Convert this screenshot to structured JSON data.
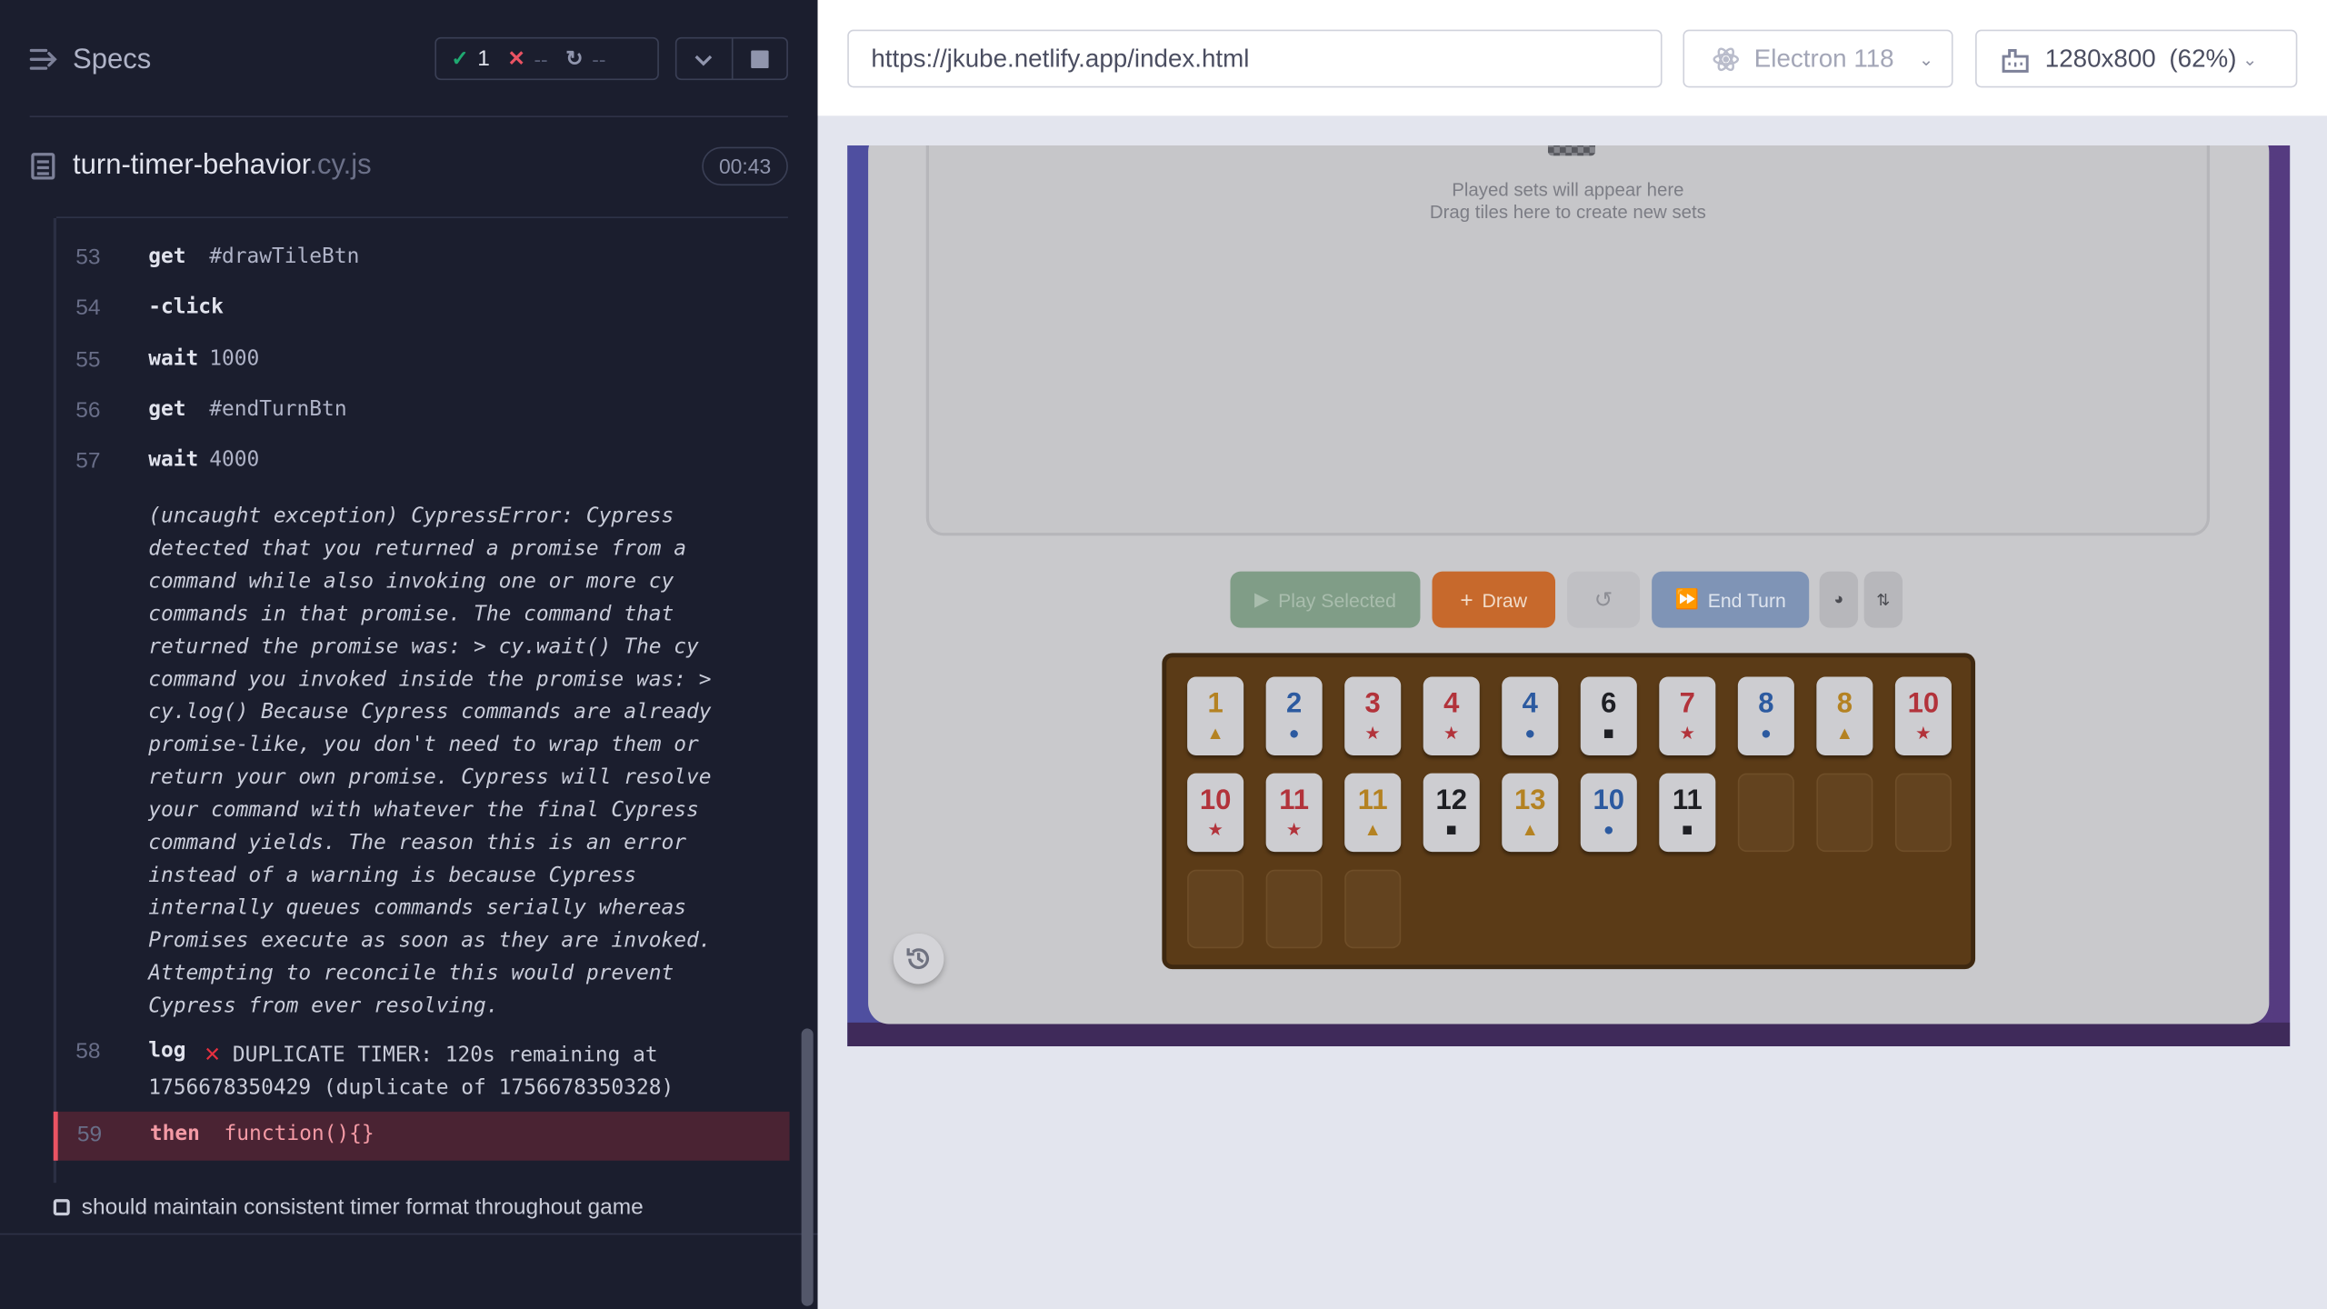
{
  "reporter": {
    "title": "Specs",
    "stats": {
      "passed": "1",
      "failed": "--",
      "pending": "--"
    },
    "spec": {
      "name": "turn-timer-behavior",
      "ext": ".cy.js",
      "duration": "00:43"
    },
    "commands": [
      {
        "num": "53",
        "name": "get",
        "message": "#drawTileBtn"
      },
      {
        "num": "54",
        "name": "-click",
        "message": ""
      },
      {
        "num": "55",
        "name": "wait",
        "message": "1000"
      },
      {
        "num": "56",
        "name": "get",
        "message": "#endTurnBtn"
      },
      {
        "num": "57",
        "name": "wait",
        "message": "4000"
      }
    ],
    "error_text": "(uncaught exception)  CypressError: Cypress detected that you returned a promise from a command while also invoking one or more cy commands in that promise. The command that returned the promise was: > cy.wait() The cy command you invoked inside the promise was: > cy.log() Because Cypress commands are already promise-like, you don't need to wrap them or return your own promise. Cypress will resolve your command with whatever the final Cypress command yields. The reason this is an error instead of a warning is because Cypress internally queues commands serially whereas Promises execute as soon as they are invoked. Attempting to reconcile this would prevent Cypress from ever resolving.",
    "log_command": {
      "num": "58",
      "name": "log",
      "message_line1": "DUPLICATE TIMER: 120s remaining at",
      "message_line2": "1756678350429 (duplicate of 1756678350328)"
    },
    "active_command": {
      "num": "59",
      "name": "then",
      "message": "function(){}"
    },
    "next_test": "should maintain consistent timer format throughout game"
  },
  "browser": {
    "url": "https://jkube.netlify.app/index.html",
    "browser_name": "Electron 118",
    "viewport": "1280x800",
    "scale": "(62%)"
  },
  "game": {
    "board_placeholder_1": "Played sets will appear here",
    "board_placeholder_2": "Drag tiles here to create new sets",
    "buttons": {
      "play": "Play Selected",
      "draw": "Draw",
      "end_turn": "End Turn"
    },
    "rack_row1": [
      {
        "value": "1",
        "color": "gold",
        "symbol": "▲"
      },
      {
        "value": "2",
        "color": "blue",
        "symbol": "●"
      },
      {
        "value": "3",
        "color": "red",
        "symbol": "★"
      },
      {
        "value": "4",
        "color": "red",
        "symbol": "★"
      },
      {
        "value": "4",
        "color": "blue",
        "symbol": "●"
      },
      {
        "value": "6",
        "color": "black",
        "symbol": "■"
      },
      {
        "value": "7",
        "color": "red",
        "symbol": "★"
      },
      {
        "value": "8",
        "color": "blue",
        "symbol": "●"
      },
      {
        "value": "8",
        "color": "gold",
        "symbol": "▲"
      },
      {
        "value": "10",
        "color": "red",
        "symbol": "★"
      }
    ],
    "rack_row2": [
      {
        "value": "10",
        "color": "red",
        "symbol": "★"
      },
      {
        "value": "11",
        "color": "red",
        "symbol": "★"
      },
      {
        "value": "11",
        "color": "gold",
        "symbol": "▲"
      },
      {
        "value": "12",
        "color": "black",
        "symbol": "■"
      },
      {
        "value": "13",
        "color": "gold",
        "symbol": "▲"
      },
      {
        "value": "10",
        "color": "blue",
        "symbol": "●"
      },
      {
        "value": "11",
        "color": "black",
        "symbol": "■"
      }
    ]
  },
  "colors": {
    "pass": "#1fa971",
    "fail": "#ea5363",
    "panel_bg": "#1b1e2e",
    "accent_draw": "#c7692c"
  }
}
